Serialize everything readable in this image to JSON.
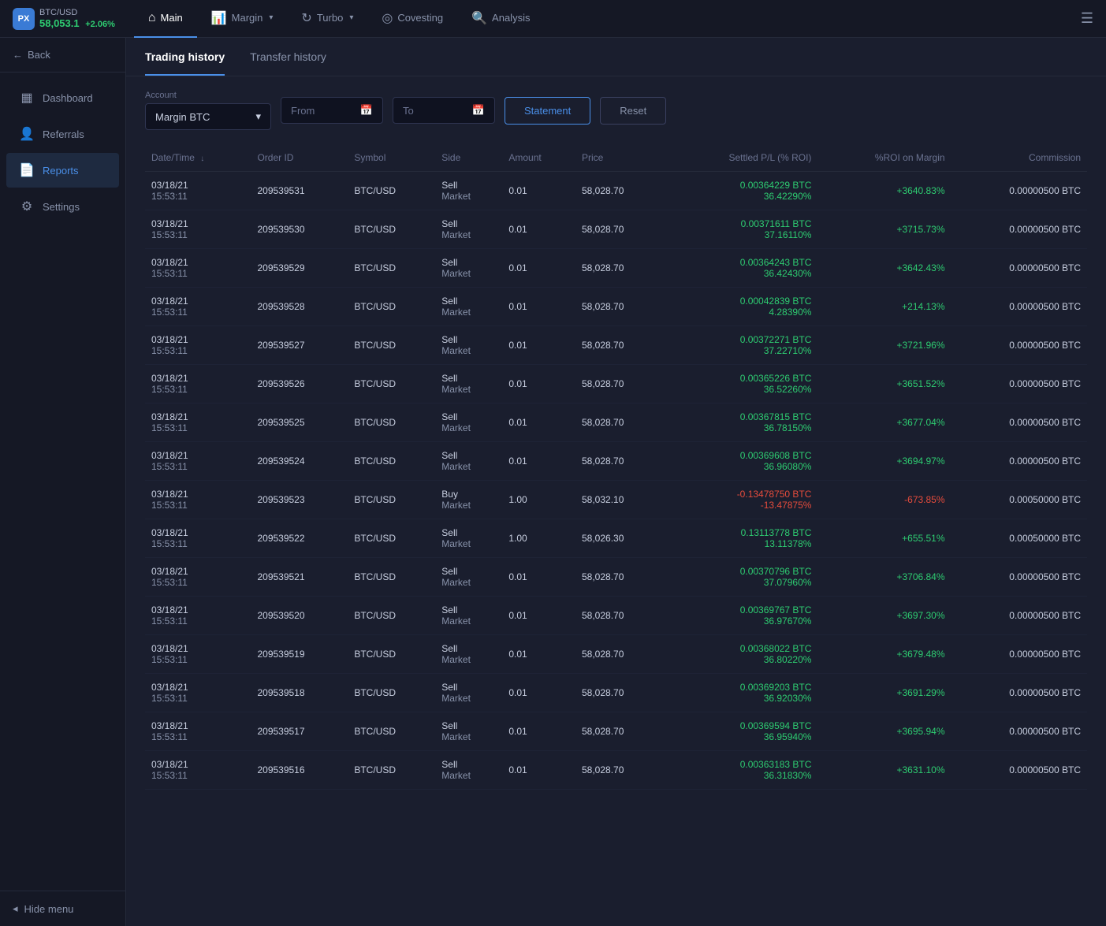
{
  "app": {
    "logo": "PX",
    "ticker": {
      "pair": "BTC/USD",
      "price": "58,053.1",
      "change": "+2.06%"
    }
  },
  "topnav": {
    "items": [
      {
        "label": "Main",
        "icon": "⌂",
        "active": true,
        "hasCaret": false
      },
      {
        "label": "Margin",
        "icon": "📊",
        "active": false,
        "hasCaret": true
      },
      {
        "label": "Turbo",
        "icon": "↻",
        "active": false,
        "hasCaret": true
      },
      {
        "label": "Covesting",
        "icon": "◎",
        "active": false,
        "hasCaret": false
      },
      {
        "label": "Analysis",
        "icon": "🔍",
        "active": false,
        "hasCaret": false
      }
    ],
    "menu_icon": "☰"
  },
  "sidebar": {
    "back_label": "Back",
    "items": [
      {
        "label": "Dashboard",
        "icon": "▦",
        "active": false
      },
      {
        "label": "Referrals",
        "icon": "👤",
        "active": false
      },
      {
        "label": "Reports",
        "icon": "📄",
        "active": true
      },
      {
        "label": "Settings",
        "icon": "⚙",
        "active": false
      }
    ],
    "hide_menu_label": "Hide menu"
  },
  "tabs": [
    {
      "label": "Trading history",
      "active": true
    },
    {
      "label": "Transfer history",
      "active": false
    }
  ],
  "filters": {
    "account_label": "Account",
    "account_value": "Margin BTC",
    "from_placeholder": "From",
    "to_placeholder": "To",
    "statement_label": "Statement",
    "reset_label": "Reset"
  },
  "table": {
    "columns": [
      {
        "label": "Date/Time",
        "key": "datetime",
        "sortable": true,
        "align": "left"
      },
      {
        "label": "Order ID",
        "key": "orderid",
        "align": "left"
      },
      {
        "label": "Symbol",
        "key": "symbol",
        "align": "left"
      },
      {
        "label": "Side",
        "key": "side",
        "align": "left"
      },
      {
        "label": "Amount",
        "key": "amount",
        "align": "left"
      },
      {
        "label": "Price",
        "key": "price",
        "align": "left"
      },
      {
        "label": "Settled P/L (% ROI)",
        "key": "pnl",
        "align": "right"
      },
      {
        "label": "%ROI on Margin",
        "key": "roi",
        "align": "right"
      },
      {
        "label": "Commission",
        "key": "commission",
        "align": "right"
      }
    ],
    "rows": [
      {
        "datetime": "03/18/21\n15:53:11",
        "orderid": "209539531",
        "symbol": "BTC/USD",
        "side": "Sell\nMarket",
        "amount": "0.01",
        "price": "58,028.70",
        "pnl": "0.00364229 BTC\n36.42290%",
        "pnl_color": "green",
        "roi": "+3640.83%",
        "roi_color": "green",
        "commission": "0.00000500 BTC"
      },
      {
        "datetime": "03/18/21\n15:53:11",
        "orderid": "209539530",
        "symbol": "BTC/USD",
        "side": "Sell\nMarket",
        "amount": "0.01",
        "price": "58,028.70",
        "pnl": "0.00371611 BTC\n37.16110%",
        "pnl_color": "green",
        "roi": "+3715.73%",
        "roi_color": "green",
        "commission": "0.00000500 BTC"
      },
      {
        "datetime": "03/18/21\n15:53:11",
        "orderid": "209539529",
        "symbol": "BTC/USD",
        "side": "Sell\nMarket",
        "amount": "0.01",
        "price": "58,028.70",
        "pnl": "0.00364243 BTC\n36.42430%",
        "pnl_color": "green",
        "roi": "+3642.43%",
        "roi_color": "green",
        "commission": "0.00000500 BTC"
      },
      {
        "datetime": "03/18/21\n15:53:11",
        "orderid": "209539528",
        "symbol": "BTC/USD",
        "side": "Sell\nMarket",
        "amount": "0.01",
        "price": "58,028.70",
        "pnl": "0.00042839 BTC\n4.28390%",
        "pnl_color": "green",
        "roi": "+214.13%",
        "roi_color": "green",
        "commission": "0.00000500 BTC"
      },
      {
        "datetime": "03/18/21\n15:53:11",
        "orderid": "209539527",
        "symbol": "BTC/USD",
        "side": "Sell\nMarket",
        "amount": "0.01",
        "price": "58,028.70",
        "pnl": "0.00372271 BTC\n37.22710%",
        "pnl_color": "green",
        "roi": "+3721.96%",
        "roi_color": "green",
        "commission": "0.00000500 BTC"
      },
      {
        "datetime": "03/18/21\n15:53:11",
        "orderid": "209539526",
        "symbol": "BTC/USD",
        "side": "Sell\nMarket",
        "amount": "0.01",
        "price": "58,028.70",
        "pnl": "0.00365226 BTC\n36.52260%",
        "pnl_color": "green",
        "roi": "+3651.52%",
        "roi_color": "green",
        "commission": "0.00000500 BTC"
      },
      {
        "datetime": "03/18/21\n15:53:11",
        "orderid": "209539525",
        "symbol": "BTC/USD",
        "side": "Sell\nMarket",
        "amount": "0.01",
        "price": "58,028.70",
        "pnl": "0.00367815 BTC\n36.78150%",
        "pnl_color": "green",
        "roi": "+3677.04%",
        "roi_color": "green",
        "commission": "0.00000500 BTC"
      },
      {
        "datetime": "03/18/21\n15:53:11",
        "orderid": "209539524",
        "symbol": "BTC/USD",
        "side": "Sell\nMarket",
        "amount": "0.01",
        "price": "58,028.70",
        "pnl": "0.00369608 BTC\n36.96080%",
        "pnl_color": "green",
        "roi": "+3694.97%",
        "roi_color": "green",
        "commission": "0.00000500 BTC"
      },
      {
        "datetime": "03/18/21\n15:53:11",
        "orderid": "209539523",
        "symbol": "BTC/USD",
        "side": "Buy\nMarket",
        "amount": "1.00",
        "price": "58,032.10",
        "pnl": "-0.13478750 BTC\n-13.47875%",
        "pnl_color": "red",
        "roi": "-673.85%",
        "roi_color": "red",
        "commission": "0.00050000 BTC"
      },
      {
        "datetime": "03/18/21\n15:53:11",
        "orderid": "209539522",
        "symbol": "BTC/USD",
        "side": "Sell\nMarket",
        "amount": "1.00",
        "price": "58,026.30",
        "pnl": "0.13113778 BTC\n13.11378%",
        "pnl_color": "green",
        "roi": "+655.51%",
        "roi_color": "green",
        "commission": "0.00050000 BTC"
      },
      {
        "datetime": "03/18/21\n15:53:11",
        "orderid": "209539521",
        "symbol": "BTC/USD",
        "side": "Sell\nMarket",
        "amount": "0.01",
        "price": "58,028.70",
        "pnl": "0.00370796 BTC\n37.07960%",
        "pnl_color": "green",
        "roi": "+3706.84%",
        "roi_color": "green",
        "commission": "0.00000500 BTC"
      },
      {
        "datetime": "03/18/21\n15:53:11",
        "orderid": "209539520",
        "symbol": "BTC/USD",
        "side": "Sell\nMarket",
        "amount": "0.01",
        "price": "58,028.70",
        "pnl": "0.00369767 BTC\n36.97670%",
        "pnl_color": "green",
        "roi": "+3697.30%",
        "roi_color": "green",
        "commission": "0.00000500 BTC"
      },
      {
        "datetime": "03/18/21\n15:53:11",
        "orderid": "209539519",
        "symbol": "BTC/USD",
        "side": "Sell\nMarket",
        "amount": "0.01",
        "price": "58,028.70",
        "pnl": "0.00368022 BTC\n36.80220%",
        "pnl_color": "green",
        "roi": "+3679.48%",
        "roi_color": "green",
        "commission": "0.00000500 BTC"
      },
      {
        "datetime": "03/18/21\n15:53:11",
        "orderid": "209539518",
        "symbol": "BTC/USD",
        "side": "Sell\nMarket",
        "amount": "0.01",
        "price": "58,028.70",
        "pnl": "0.00369203 BTC\n36.92030%",
        "pnl_color": "green",
        "roi": "+3691.29%",
        "roi_color": "green",
        "commission": "0.00000500 BTC"
      },
      {
        "datetime": "03/18/21\n15:53:11",
        "orderid": "209539517",
        "symbol": "BTC/USD",
        "side": "Sell\nMarket",
        "amount": "0.01",
        "price": "58,028.70",
        "pnl": "0.00369594 BTC\n36.95940%",
        "pnl_color": "green",
        "roi": "+3695.94%",
        "roi_color": "green",
        "commission": "0.00000500 BTC"
      },
      {
        "datetime": "03/18/21\n15:53:11",
        "orderid": "209539516",
        "symbol": "BTC/USD",
        "side": "Sell\nMarket",
        "amount": "0.01",
        "price": "58,028.70",
        "pnl": "0.00363183 BTC\n36.31830%",
        "pnl_color": "green",
        "roi": "+3631.10%",
        "roi_color": "green",
        "commission": "0.00000500 BTC"
      }
    ]
  }
}
